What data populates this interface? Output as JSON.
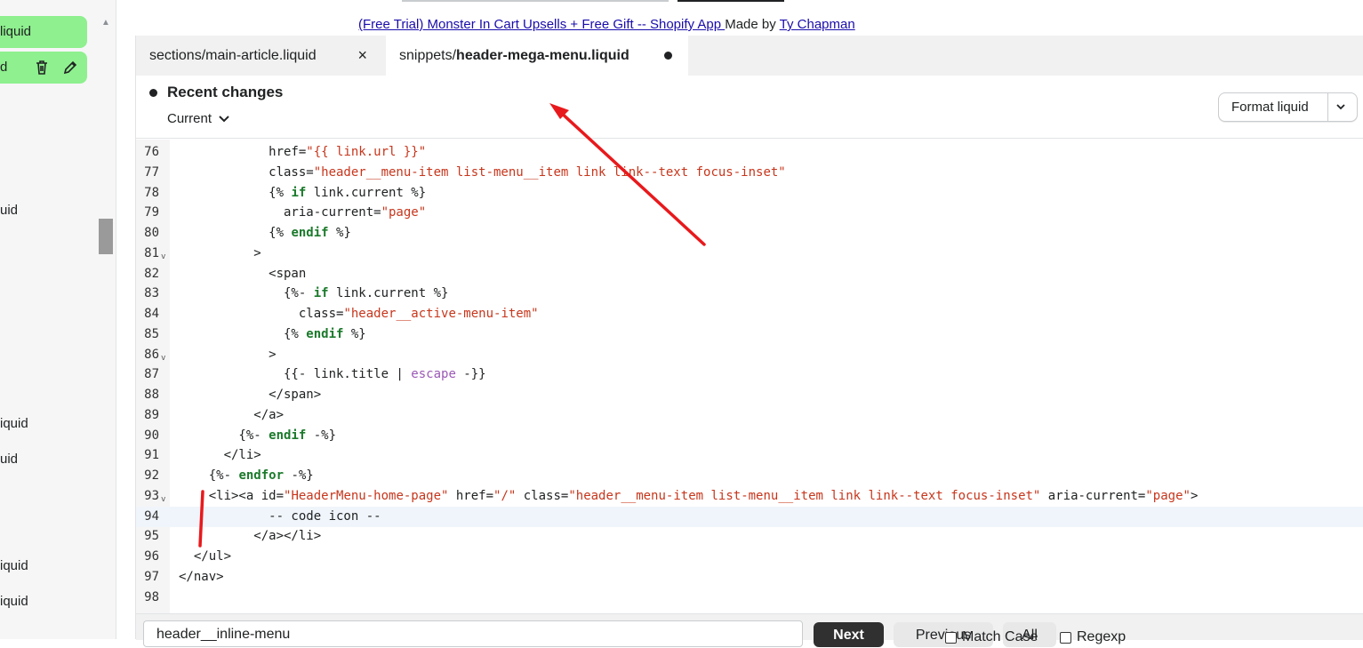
{
  "sidebar": {
    "items": [
      {
        "label": "liquid",
        "top": 0
      },
      {
        "label": "d",
        "top": 0
      },
      {
        "label": "uid"
      },
      {
        "label": "iquid"
      },
      {
        "label": "uid"
      },
      {
        "label": "iquid"
      },
      {
        "label": "iquid"
      }
    ],
    "active_colors": "#8ef08e"
  },
  "banner": {
    "link1": "(Free Trial) Monster In Cart Upsells + Free Gift -- Shopify App ",
    "middle": "Made by ",
    "link2": "Ty Chapman"
  },
  "tabs": [
    {
      "label": "sections/main-article.liquid",
      "close": "×"
    },
    {
      "prefix": "snippets/",
      "label": "header-mega-menu.liquid"
    }
  ],
  "header": {
    "title": "Recent changes",
    "version": "Current",
    "format_button": "Format liquid"
  },
  "code": {
    "lines": [
      {
        "n": "76",
        "fold": "",
        "html": "            href=<span class=\"str\">\"{{ link.url }}\"</span>"
      },
      {
        "n": "77",
        "fold": "",
        "html": "            class=<span class=\"str\">\"header__menu-item list-menu__item link link--text focus-inset\"</span>"
      },
      {
        "n": "78",
        "fold": "",
        "html": "            {% <span class=\"kw\">if</span> link.current %}"
      },
      {
        "n": "79",
        "fold": "",
        "html": "              aria-current=<span class=\"str\">\"page\"</span>"
      },
      {
        "n": "80",
        "fold": "",
        "html": "            {% <span class=\"kw\">endif</span> %}"
      },
      {
        "n": "81",
        "fold": "v",
        "html": "          >"
      },
      {
        "n": "82",
        "fold": "",
        "html": "            &lt;span"
      },
      {
        "n": "83",
        "fold": "",
        "html": "              {%- <span class=\"kw\">if</span> link.current %}"
      },
      {
        "n": "84",
        "fold": "",
        "html": "                class=<span class=\"str\">\"header__active-menu-item\"</span>"
      },
      {
        "n": "85",
        "fold": "",
        "html": "              {% <span class=\"kw\">endif</span> %}"
      },
      {
        "n": "86",
        "fold": "v",
        "html": "            >"
      },
      {
        "n": "87",
        "fold": "",
        "html": "              {{- link.title | <span class=\"pipe\">escape</span> -}}"
      },
      {
        "n": "88",
        "fold": "",
        "html": "            &lt;/span&gt;"
      },
      {
        "n": "89",
        "fold": "",
        "html": "          &lt;/a&gt;"
      },
      {
        "n": "90",
        "fold": "",
        "html": "        {%- <span class=\"kw\">endif</span> -%}"
      },
      {
        "n": "91",
        "fold": "",
        "html": "      &lt;/li&gt;"
      },
      {
        "n": "92",
        "fold": "",
        "html": "    {%- <span class=\"kw\">endfor</span> -%}"
      },
      {
        "n": "93",
        "fold": "v",
        "html": "    &lt;li&gt;&lt;a id=<span class=\"str\">\"HeaderMenu-home-page\"</span> href=<span class=\"str\">\"/\"</span> class=<span class=\"str\">\"header__menu-item list-menu__item link link--text focus-inset\"</span> aria-current=<span class=\"str\">\"page\"</span>&gt;"
      },
      {
        "n": "94",
        "fold": "",
        "html": "            -- code icon --"
      },
      {
        "n": "95",
        "fold": "",
        "html": "          &lt;/a&gt;&lt;/li&gt;"
      },
      {
        "n": "96",
        "fold": "",
        "html": "  &lt;/ul&gt;"
      },
      {
        "n": "97",
        "fold": "",
        "html": "&lt;/nav&gt;"
      },
      {
        "n": "98",
        "fold": "",
        "html": ""
      }
    ],
    "highlighted_line": "94"
  },
  "find": {
    "value": "header__inline-menu",
    "next": "Next",
    "previous": "Previous",
    "all": "All",
    "match_case": "Match Case",
    "regexp": "Regexp"
  },
  "colors": {
    "string": "#c7361c",
    "keyword": "#1b7a2b",
    "filter": "#9b59b6",
    "annotation": "#e8191c"
  }
}
